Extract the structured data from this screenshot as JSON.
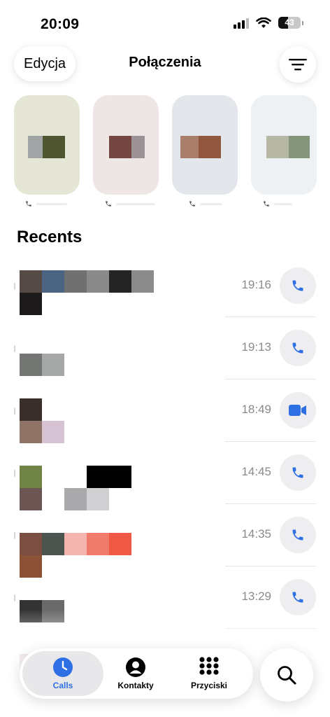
{
  "status": {
    "time": "20:09",
    "battery": "43",
    "battery_level": 0.43
  },
  "header": {
    "edit_label": "Edycja",
    "title": "Połączenia"
  },
  "section": {
    "recents_title": "Recents"
  },
  "recents": [
    {
      "time": "19:16",
      "action_icon": "phone-icon"
    },
    {
      "time": "19:13",
      "action_icon": "phone-icon"
    },
    {
      "time": "18:49",
      "action_icon": "video-icon"
    },
    {
      "time": "14:45",
      "action_icon": "phone-icon"
    },
    {
      "time": "14:35",
      "action_icon": "phone-icon"
    },
    {
      "time": "13:29",
      "action_icon": "phone-icon"
    }
  ],
  "tabs": [
    {
      "label": "Calls",
      "icon": "clock-icon"
    },
    {
      "label": "Kontakty",
      "icon": "person-icon"
    },
    {
      "label": "Przyciski",
      "icon": "keypad-icon"
    }
  ],
  "colors": {
    "accent": "#2f6fe4",
    "time_text": "#8a8a8e"
  }
}
